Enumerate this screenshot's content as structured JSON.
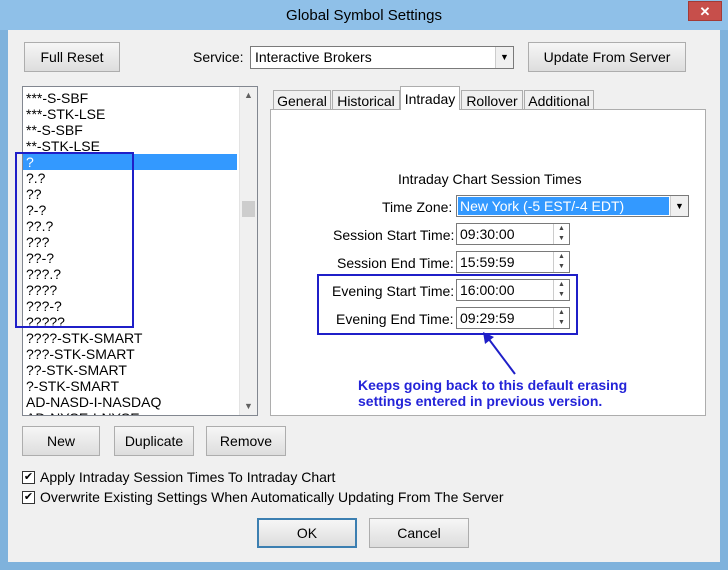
{
  "window": {
    "title": "Global Symbol Settings",
    "close_glyph": "✕"
  },
  "toolbar": {
    "full_reset": "Full Reset",
    "service_label": "Service:",
    "service_value": "Interactive Brokers",
    "update_from_server": "Update From Server"
  },
  "symbols": {
    "items": [
      "***-S-SBF",
      "***-STK-LSE",
      "**-S-SBF",
      "**-STK-LSE",
      "?",
      "?.?",
      "??",
      "?-?",
      "??.?",
      "???",
      "??-?",
      "???.?",
      "????",
      "???-?",
      "?????",
      "????-STK-SMART",
      "???-STK-SMART",
      "??-STK-SMART",
      "?-STK-SMART",
      "AD-NASD-I-NASDAQ",
      "AD-NYSE-I-NYSE"
    ],
    "selected": "?"
  },
  "tabs": [
    "General",
    "Historical",
    "Intraday",
    "Rollover",
    "Additional"
  ],
  "active_tab": "Intraday",
  "intraday": {
    "section_title": "Intraday Chart Session Times",
    "time_zone_label": "Time Zone:",
    "time_zone_value": "New York (-5 EST/-4 EDT)",
    "session_start_label": "Session Start Time:",
    "session_start_value": "09:30:00",
    "session_end_label": "Session End Time:",
    "session_end_value": "15:59:59",
    "evening_start_label": "Evening Start Time:",
    "evening_start_value": "16:00:00",
    "evening_end_label": "Evening End Time:",
    "evening_end_value": "09:29:59"
  },
  "annotation": {
    "line1": "Keeps going back to this default erasing",
    "line2": "settings entered in previous version."
  },
  "list_buttons": {
    "new": "New",
    "duplicate": "Duplicate",
    "remove": "Remove"
  },
  "options": {
    "apply_intraday": {
      "label": "Apply Intraday Session Times To Intraday Chart",
      "checked": true
    },
    "overwrite_existing": {
      "label": "Overwrite Existing Settings When Automatically Updating From The Server",
      "checked": true
    }
  },
  "footer": {
    "ok": "OK",
    "cancel": "Cancel"
  },
  "colors": {
    "annotation": "#1f1fc8",
    "selection": "#3399ff",
    "title_bar": "#8fc0e8"
  }
}
